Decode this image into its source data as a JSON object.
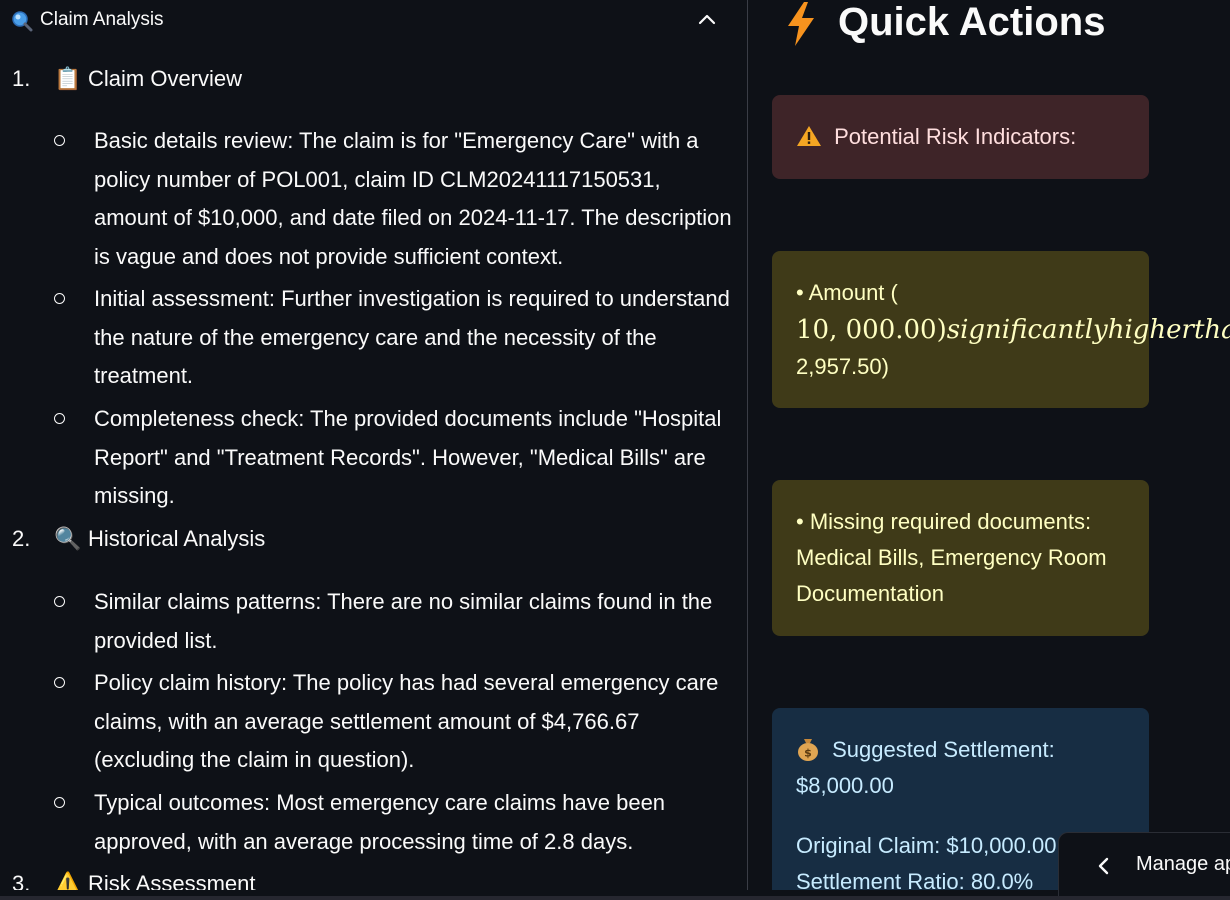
{
  "expander": {
    "title": "Claim Analysis",
    "icon": "magnifier-icon"
  },
  "sections": [
    {
      "number": "1.",
      "emoji": "📋",
      "label": "Claim Overview",
      "bullets": [
        "Basic details review: The claim is for \"Emergency Care\" with a policy number of POL001, claim ID CLM20241117150531, amount of $10,000, and date filed on 2024-11-17. The description is vague and does not provide sufficient context.",
        "Initial assessment: Further investigation is required to understand the nature of the emergency care and the necessity of the treatment.",
        "Completeness check: The provided documents include \"Hospital Report\" and \"Treatment Records\". However, \"Medical Bills\" are missing."
      ]
    },
    {
      "number": "2.",
      "emoji": "🔍",
      "label": "Historical Analysis",
      "bullets": [
        "Similar claims patterns: There are no similar claims found in the provided list.",
        "Policy claim history: The policy has had several emergency care claims, with an average settlement amount of $4,766.67 (excluding the claim in question).",
        "Typical outcomes: Most emergency care claims have been approved, with an average processing time of 2.8 days."
      ]
    },
    {
      "number": "3.",
      "emoji": "⚠️",
      "label": "Risk Assessment",
      "bullets": []
    }
  ],
  "quick_actions": {
    "title": "Quick Actions",
    "risk_header": "Potential Risk Indicators:",
    "amount_prefix": "• Amount (",
    "amount_math_number": "10, 000.00)",
    "amount_math_text": "significantlyhigherthan",
    "amount_suffix": "2,957.50)",
    "missing_docs": "• Missing required documents: Medical Bills, Emergency Room Documentation",
    "settlement_header": "Suggested Settlement:",
    "settlement_amount": "$8,000.00",
    "original_claim": "Original Claim: $10,000.00",
    "settlement_ratio": "Settlement Ratio: 80.0%"
  },
  "manage_app": {
    "label": "Manage app"
  },
  "colors": {
    "background": "#0e1117",
    "error_card": "#3e2428",
    "warning_card": "#3f3a18",
    "info_card": "#172d43"
  }
}
